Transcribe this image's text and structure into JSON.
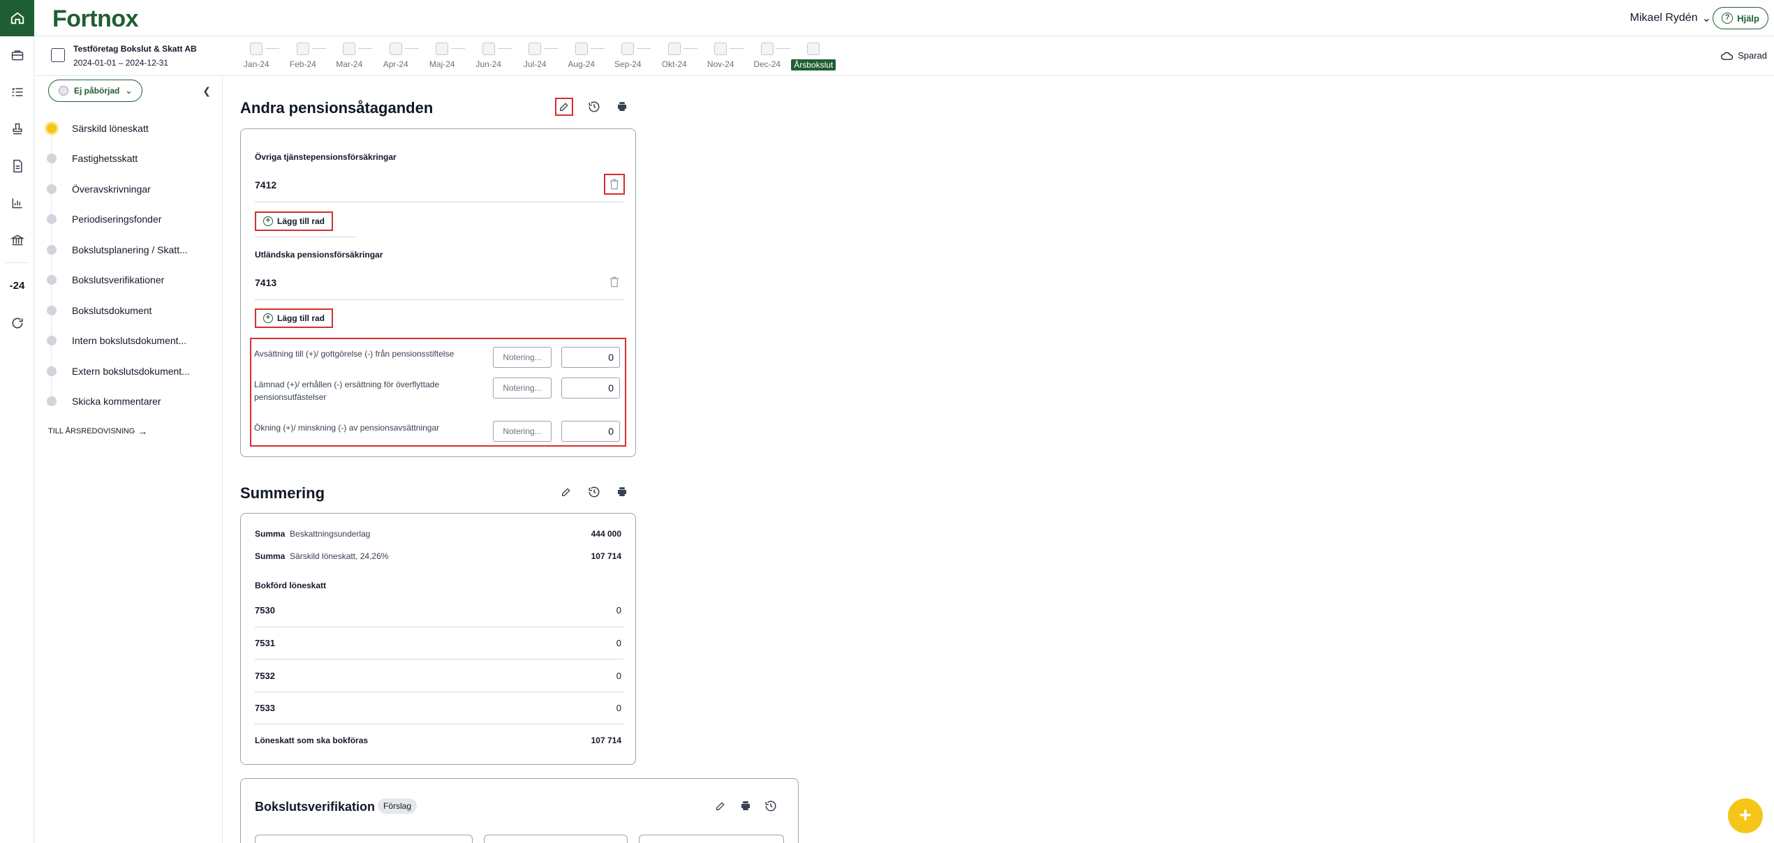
{
  "app": {
    "logo": "Fortnox",
    "user_name": "Mikael Rydén",
    "help_label": "Hjälp",
    "saved_label": "Sparad"
  },
  "rail": {
    "year_label": "-24"
  },
  "company": {
    "name": "Testföretag Bokslut & Skatt AB",
    "period": "2024-01-01 – 2024-12-31"
  },
  "months": [
    "Jan-24",
    "Feb-24",
    "Mar-24",
    "Apr-24",
    "Maj-24",
    "Jun-24",
    "Jul-24",
    "Aug-24",
    "Sep-24",
    "Okt-24",
    "Nov-24",
    "Dec-24",
    "Årsbokslut"
  ],
  "active_month": "Årsbokslut",
  "sidebar": {
    "status_label": "Ej påbörjad",
    "steps": [
      "Särskild löneskatt",
      "Fastighetsskatt",
      "Överavskrivningar",
      "Periodiseringsfonder",
      "Bokslutsplanering / Skatt...",
      "Bokslutsverifikationer",
      "Bokslutsdokument",
      "Intern bokslutsdokument...",
      "Extern bokslutsdokument...",
      "Skicka kommentarer"
    ],
    "active_step": "Särskild löneskatt",
    "to_annual_report": "TILL ÅRSREDOVISNING"
  },
  "pension": {
    "title": "Andra pensionsåtaganden",
    "group1": {
      "title": "Övriga tjänstepensionsförsäkringar",
      "account": "7412",
      "add_label": "Lägg till rad"
    },
    "group2": {
      "title": "Utländska pensionsförsäkringar",
      "account": "7413",
      "add_label": "Lägg till rad"
    },
    "rows": [
      {
        "label": "Avsättning till (+)/ gottgörelse (-) från pensionsstiftelse",
        "note_placeholder": "Notering...",
        "value": "0"
      },
      {
        "label": "Lämnad (+)/ erhållen (-) ersättning för överflyttade pensionsutfästelser",
        "note_placeholder": "Notering...",
        "value": "0"
      },
      {
        "label": "Ökning (+)/ minskning (-) av pensionsavsättningar",
        "note_placeholder": "Notering...",
        "value": "0"
      }
    ]
  },
  "summary": {
    "title": "Summering",
    "rows": [
      {
        "prefix": "Summa",
        "label": "Beskattningsunderlag",
        "value": "444 000"
      },
      {
        "prefix": "Summa",
        "label": "Särskild löneskatt, 24,26%",
        "value": "107 714"
      }
    ],
    "booked_title": "Bokförd löneskatt",
    "accounts": [
      {
        "account": "7530",
        "value": "0"
      },
      {
        "account": "7531",
        "value": "0"
      },
      {
        "account": "7532",
        "value": "0"
      },
      {
        "account": "7533",
        "value": "0"
      }
    ],
    "total_label": "Löneskatt som ska bokföras",
    "total_value": "107 714"
  },
  "verification": {
    "title": "Bokslutsverifikation",
    "badge": "Förslag"
  },
  "fab_label": "+"
}
